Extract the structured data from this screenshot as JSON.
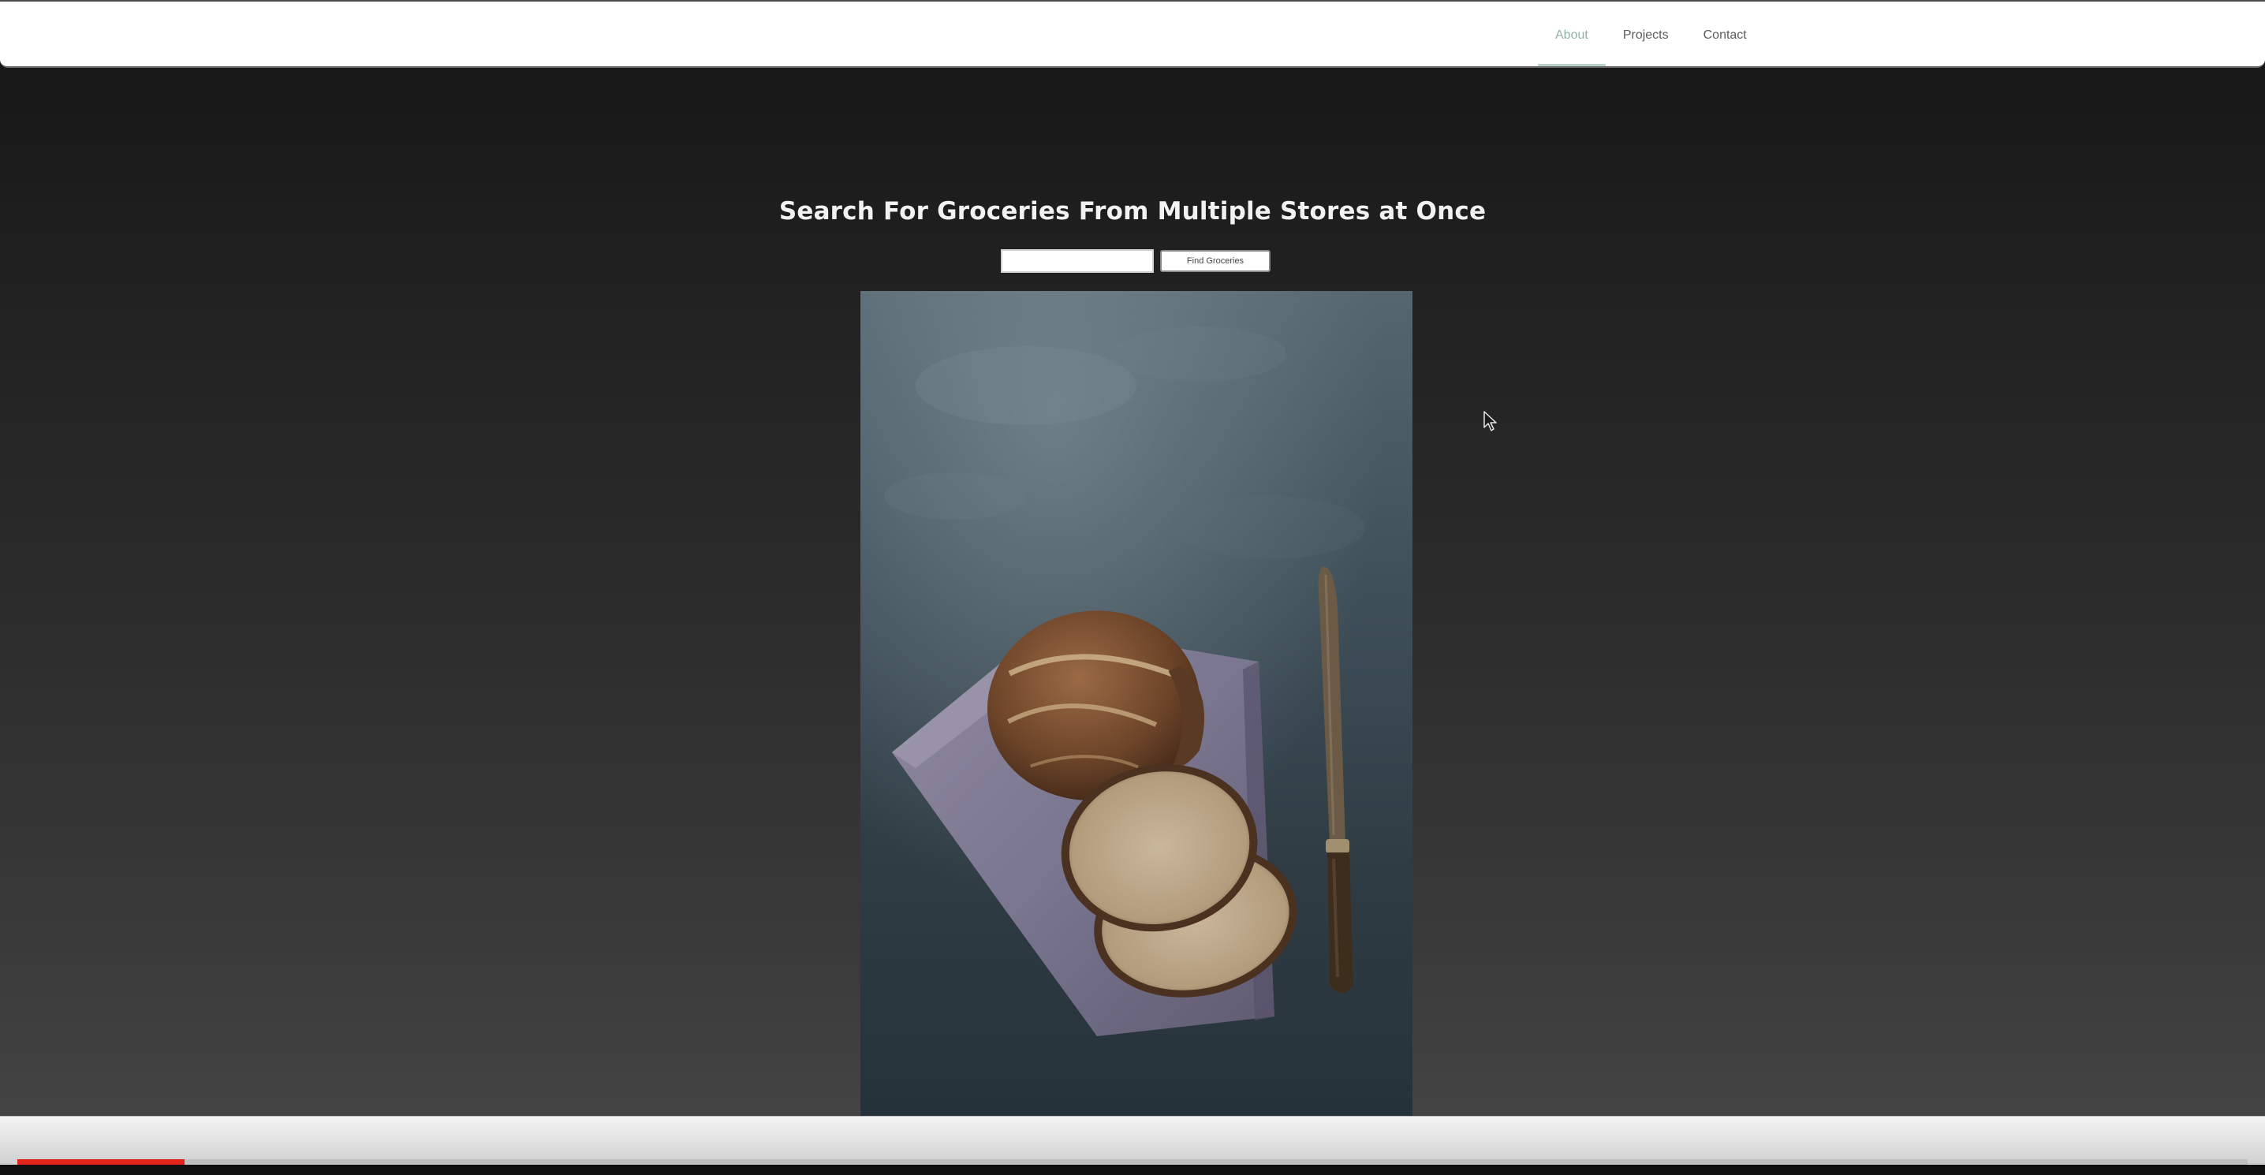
{
  "nav": {
    "items": [
      {
        "label": "About",
        "active": true
      },
      {
        "label": "Projects",
        "active": false
      },
      {
        "label": "Contact",
        "active": false
      }
    ],
    "active_color": "#8fb3a4"
  },
  "hero": {
    "title": "Search For Groceries From Multiple Stores at Once",
    "search": {
      "value": "",
      "placeholder": ""
    },
    "button_label": "Find Groceries",
    "image": {
      "subject": "bread-loaf-on-linen-with-knife"
    }
  },
  "player": {
    "progress_fraction": 0.075,
    "progress_color": "#e0241b"
  }
}
